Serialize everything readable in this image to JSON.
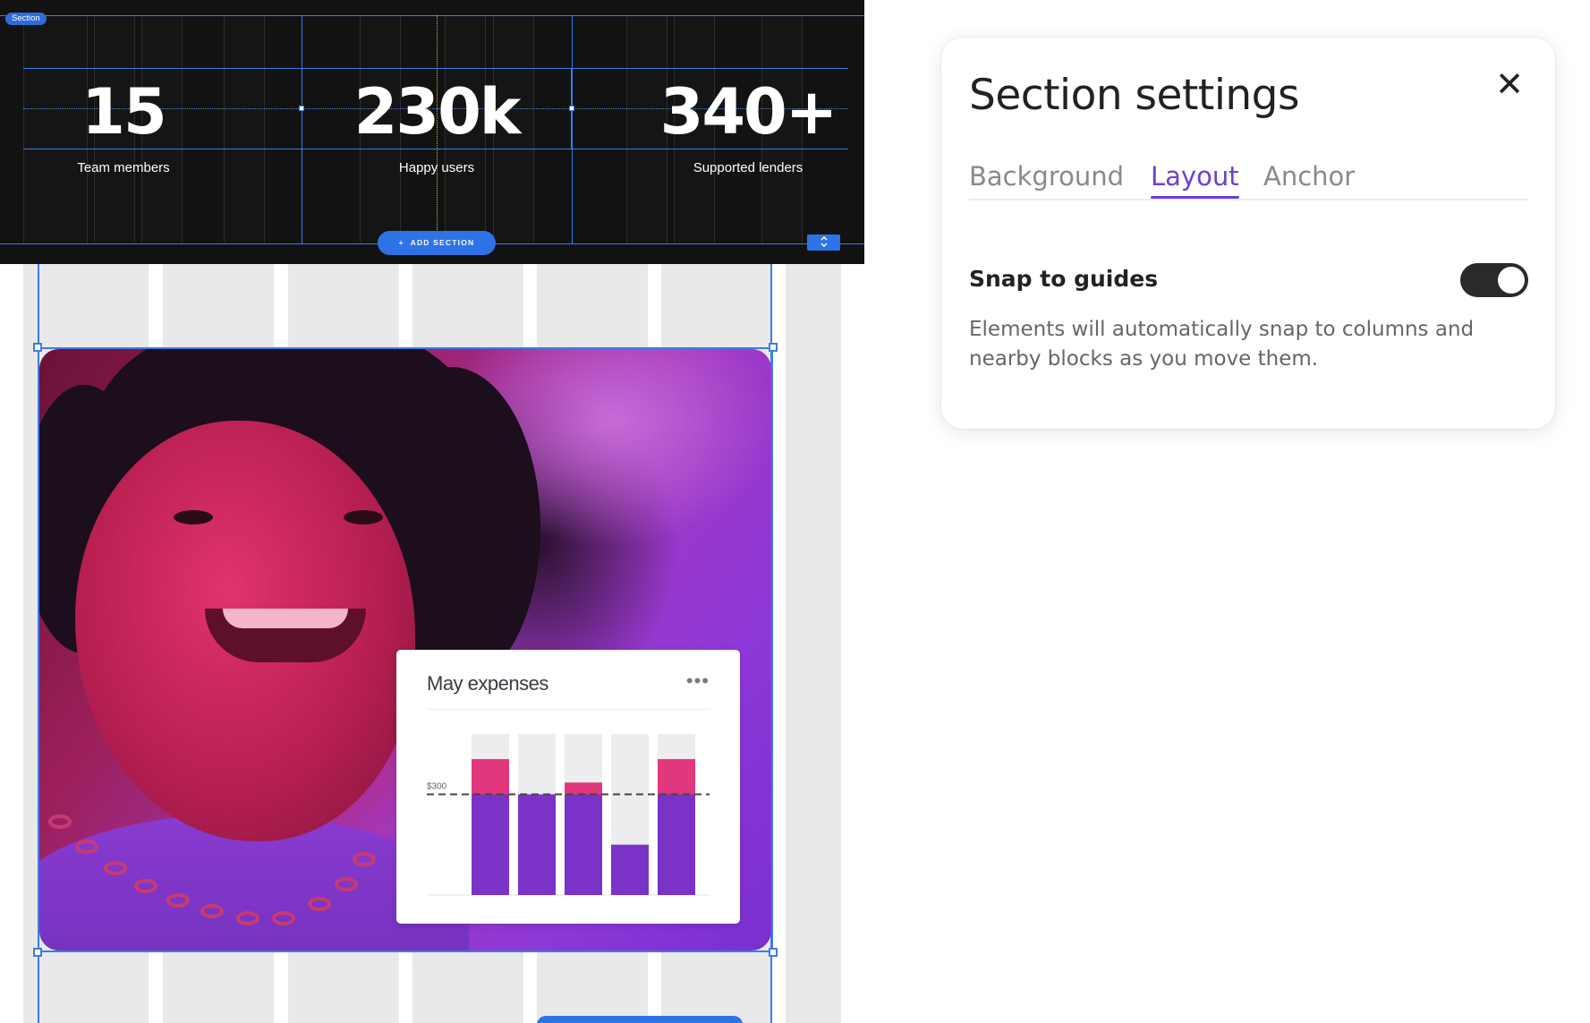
{
  "canvas": {
    "section_tag": "Section",
    "stats": [
      {
        "number": "15",
        "label": "Team members"
      },
      {
        "number": "230k",
        "label": "Happy users"
      },
      {
        "number": "340+",
        "label": "Supported lenders"
      }
    ],
    "add_section": {
      "icon": "plus-icon",
      "label": "ADD SECTION"
    },
    "resize_handle_icon": "vertical-resize-icon",
    "expense_card": {
      "title": "May expenses",
      "menu_icon": "more-horizontal-icon",
      "menu_glyph": "•••",
      "threshold_label": "$300",
      "chart_data": {
        "type": "bar",
        "categories": [
          "",
          "",
          "",
          "",
          ""
        ],
        "threshold": 300,
        "series": [
          {
            "values": [
              300,
              300,
              300,
              150,
              300
            ]
          },
          {
            "values": [
              105,
              0,
              35,
              0,
              105
            ]
          }
        ],
        "capacity": [
          480,
          480,
          480,
          480,
          480
        ],
        "colors": {
          "base": "#7a33c6",
          "over": "#e0377d",
          "capacity": "#ededf0",
          "threshold_line": "#444444"
        }
      }
    }
  },
  "panel": {
    "title": "Section settings",
    "close_glyph": "✕",
    "tabs": [
      {
        "label": "Background",
        "active": false
      },
      {
        "label": "Layout",
        "active": true
      },
      {
        "label": "Anchor",
        "active": false
      }
    ],
    "snap": {
      "label": "Snap to guides",
      "enabled": true,
      "description": "Elements will automatically snap to columns and nearby blocks as you move them."
    },
    "accent_color": "#6d3fd6"
  }
}
